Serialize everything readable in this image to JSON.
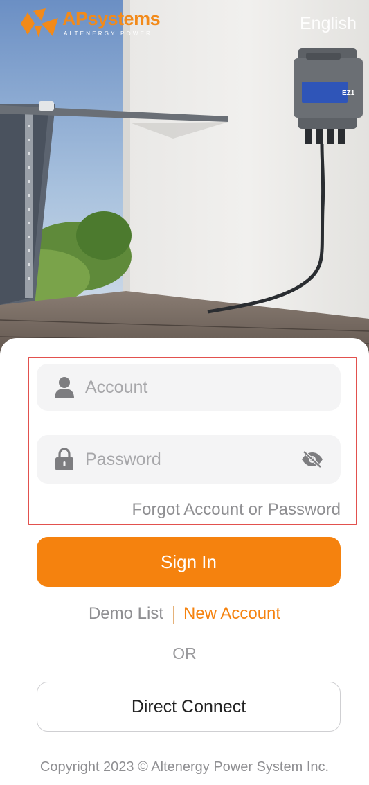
{
  "header": {
    "brand_ap": "AP",
    "brand_systems": "systems",
    "brand_tagline": "ALTENERGY POWER",
    "language": "English"
  },
  "login": {
    "account_placeholder": "Account",
    "password_placeholder": "Password",
    "forgot_label": "Forgot Account or Password",
    "signin_label": "Sign In",
    "demo_label": "Demo List",
    "new_account_label": "New Account",
    "or_label": "OR",
    "direct_connect_label": "Direct Connect"
  },
  "footer": {
    "copyright": "Copyright 2023 © Altenergy Power System Inc."
  },
  "colors": {
    "accent": "#f5820e",
    "highlight": "#e2514e"
  },
  "icons": {
    "account": "user-icon",
    "password": "lock-icon",
    "visibility": "eye-off-icon"
  }
}
